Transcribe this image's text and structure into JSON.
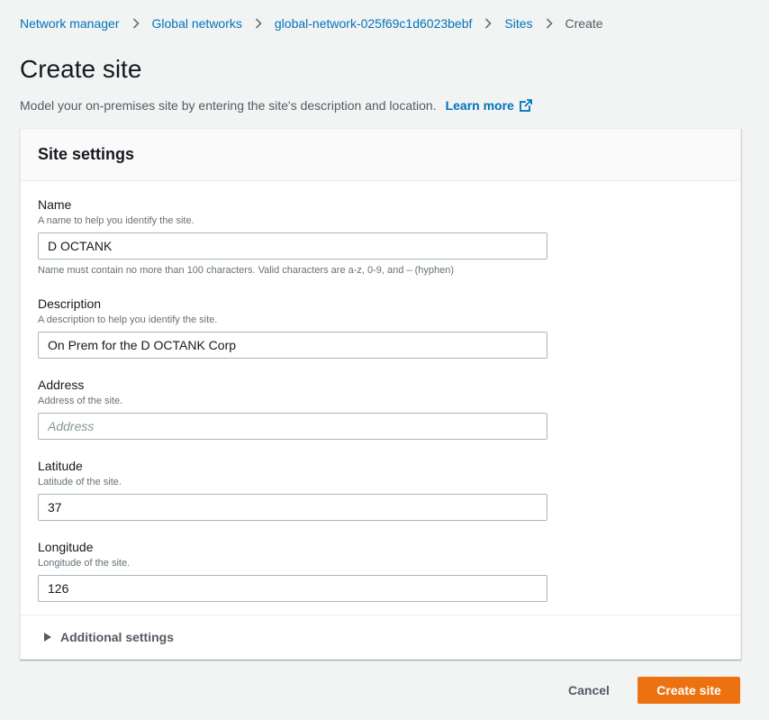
{
  "breadcrumb": {
    "items": [
      "Network manager",
      "Global networks",
      "global-network-025f69c1d6023bebf",
      "Sites"
    ],
    "current": "Create"
  },
  "page": {
    "title": "Create site",
    "description": "Model your on-premises site by entering the site's description and location.",
    "learn_more": "Learn more"
  },
  "panel": {
    "title": "Site settings",
    "fields": {
      "name": {
        "label": "Name",
        "hint": "A name to help you identify the site.",
        "value": "D OCTANK",
        "constraint": "Name must contain no more than 100 characters. Valid characters are a-z, 0-9, and – (hyphen)"
      },
      "description": {
        "label": "Description",
        "hint": "A description to help you identify the site.",
        "value": "On Prem for the D OCTANK Corp"
      },
      "address": {
        "label": "Address",
        "hint": "Address of the site.",
        "value": "",
        "placeholder": "Address"
      },
      "latitude": {
        "label": "Latitude",
        "hint": "Latitude of the site.",
        "value": "37"
      },
      "longitude": {
        "label": "Longitude",
        "hint": "Longitude of the site.",
        "value": "126"
      }
    },
    "additional_settings": "Additional settings"
  },
  "actions": {
    "cancel": "Cancel",
    "submit": "Create site"
  },
  "colors": {
    "link": "#0073bb",
    "primary": "#ec7211",
    "background": "#f2f3f3"
  }
}
